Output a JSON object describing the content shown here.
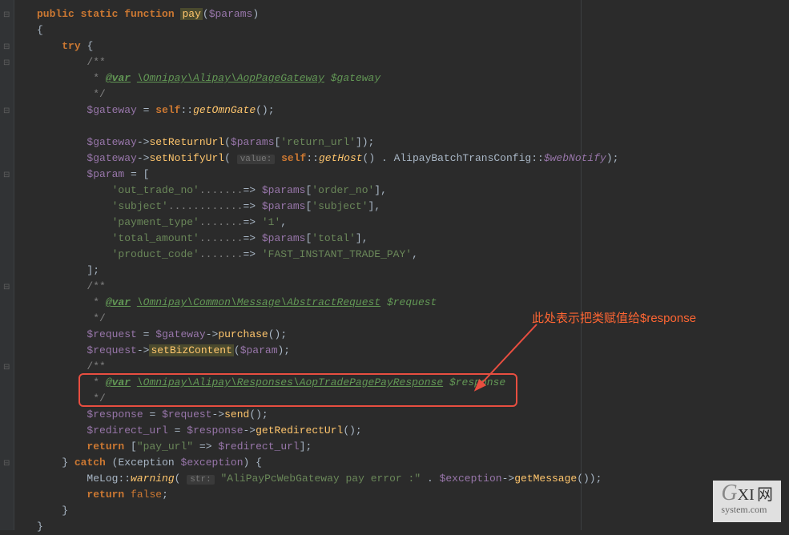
{
  "code": {
    "l1_public": "public",
    "l1_static": "static",
    "l1_function": "function",
    "l1_pay": "pay",
    "l1_params": "$params",
    "l3_try": "try",
    "l5_var": "@var",
    "l5_type": "\\Omnipay\\Alipay\\AopPageGateway",
    "l5_gv": "$gateway",
    "l7_gateway": "$gateway",
    "l7_self": "self",
    "l7_getOmn": "getOmnGate",
    "l9_gateway": "$gateway",
    "l9_setReturn": "setReturnUrl",
    "l9_params": "$params",
    "l9_return_url": "'return_url'",
    "l10_gateway": "$gateway",
    "l10_setNotify": "setNotifyUrl",
    "l10_hint": "value:",
    "l10_self": "self",
    "l10_getHost": "getHost",
    "l10_cls": "AlipayBatchTransConfig",
    "l10_web": "$webNotify",
    "l11_param": "$param",
    "l12_k": "'out_trade_no'",
    "l12_params": "$params",
    "l12_v": "'order_no'",
    "l13_k": "'subject'",
    "l13_params": "$params",
    "l13_v": "'subject'",
    "l14_k": "'payment_type'",
    "l14_v": "'1'",
    "l15_k": "'total_amount'",
    "l15_params": "$params",
    "l15_v": "'total'",
    "l16_k": "'product_code'",
    "l16_v": "'FAST_INSTANT_TRADE_PAY'",
    "l19_var": "@var",
    "l19_type": "\\Omnipay\\Common\\Message\\AbstractRequest",
    "l19_rv": "$request",
    "l21_req": "$request",
    "l21_gw": "$gateway",
    "l21_purchase": "purchase",
    "l22_req": "$request",
    "l22_setBiz": "setBizContent",
    "l22_param": "$param",
    "l24_var": "@var",
    "l24_type": "\\Omnipay\\Alipay\\Responses\\AopTradePagePayResponse",
    "l24_resp": "$response",
    "l26_resp": "$response",
    "l26_req": "$request",
    "l26_send": "send",
    "l27_redir": "$redirect_url",
    "l27_resp": "$response",
    "l27_getRed": "getRedirectUrl",
    "l28_return": "return",
    "l28_pay_url": "\"pay_url\"",
    "l28_redir": "$redirect_url",
    "l29_catch": "catch",
    "l29_exc_cls": "Exception",
    "l29_exc": "$exception",
    "l30_melog": "MeLog",
    "l30_warning": "warning",
    "l30_hint": "str:",
    "l30_msg": "\"AliPayPcWebGateway pay error :\"",
    "l30_exc": "$exception",
    "l30_getMsg": "getMessage",
    "l31_return": "return",
    "l31_false": "false"
  },
  "annotation": {
    "text": "此处表示把类赋值给$response"
  },
  "watermark": {
    "g": "G",
    "xi": "XI",
    "wang": "网",
    "sub": "system.com"
  }
}
